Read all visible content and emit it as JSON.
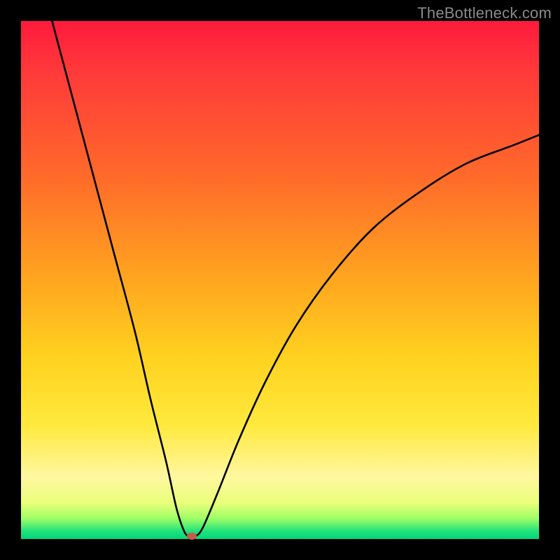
{
  "watermark": "TheBottleneck.com",
  "colors": {
    "frame": "#000000",
    "curve": "#000000",
    "marker": "#c85a4a",
    "gradient_stops": [
      "#ff1a3c",
      "#ff6a2a",
      "#ffd21f",
      "#fff7a0",
      "#20e27b"
    ]
  },
  "chart_data": {
    "type": "line",
    "title": "",
    "xlabel": "",
    "ylabel": "",
    "xlim": [
      0,
      100
    ],
    "ylim": [
      0,
      100
    ],
    "grid": false,
    "legend": false,
    "series": [
      {
        "name": "bottleneck-curve",
        "x": [
          6,
          10,
          14,
          18,
          22,
          25,
          28,
          30,
          31.5,
          32.5,
          33.5,
          35,
          38,
          42,
          47,
          53,
          60,
          68,
          77,
          86,
          95,
          100
        ],
        "y": [
          100,
          85,
          70,
          55,
          40,
          27,
          15,
          6,
          1.5,
          0.5,
          0.5,
          2,
          9,
          19,
          30,
          41,
          51,
          60,
          67,
          72.5,
          76,
          78
        ]
      }
    ],
    "annotations": [
      {
        "name": "bottleneck-minimum-marker",
        "x": 33,
        "y": 0.5
      }
    ]
  }
}
